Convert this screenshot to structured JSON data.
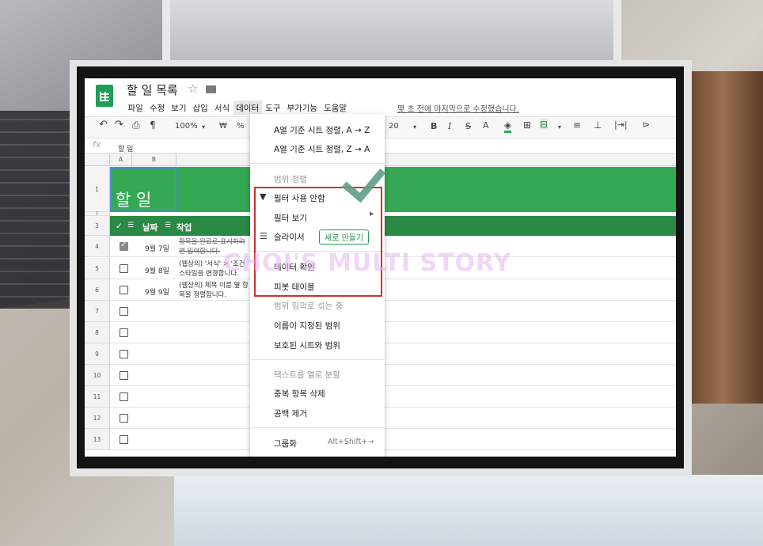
{
  "document": {
    "title": "할 일 목록",
    "fx_value": "할 일"
  },
  "menubar": [
    "파일",
    "수정",
    "보기",
    "삽입",
    "서식",
    "데이터",
    "도구",
    "부가기능",
    "도움말"
  ],
  "last_edit": "몇 초 전에 마지막으로 수정했습니다.",
  "toolbar": {
    "zoom": "100%",
    "currency": "₩",
    "percent": "%",
    "font_size": "20",
    "bold": "B",
    "italic": "I",
    "strike": "S",
    "text_color": "A"
  },
  "columns": [
    "A",
    "B"
  ],
  "sheet": {
    "title": "할 일",
    "headers": {
      "check": "✓",
      "date": "날짜",
      "task": "작업"
    },
    "rows": [
      {
        "num": "4",
        "checked": true,
        "date": "9월 7일",
        "task": "항목을 완료로 표시하려면 입력합니다."
      },
      {
        "num": "5",
        "checked": false,
        "date": "9월 8일",
        "task": "(웹상의) '서식' > '조건 스타일을 변경합니다."
      },
      {
        "num": "6",
        "checked": false,
        "date": "9월 9일",
        "task": "(웹상의) 제목 이름 옆 항목을 정렬합니다."
      },
      {
        "num": "7",
        "checked": false,
        "date": "",
        "task": ""
      },
      {
        "num": "8",
        "checked": false,
        "date": "",
        "task": ""
      },
      {
        "num": "9",
        "checked": false,
        "date": "",
        "task": ""
      },
      {
        "num": "10",
        "checked": false,
        "date": "",
        "task": ""
      },
      {
        "num": "11",
        "checked": false,
        "date": "",
        "task": ""
      },
      {
        "num": "12",
        "checked": false,
        "date": "",
        "task": ""
      },
      {
        "num": "13",
        "checked": false,
        "date": "",
        "task": ""
      }
    ]
  },
  "data_menu": {
    "sort_az": "A열 기준 시트 정렬, A → Z",
    "sort_za": "A열 기준 시트 정렬, Z → A",
    "sort_range": "범위 정렬",
    "filter_off": "필터 사용 안함",
    "filter_view": "필터 보기",
    "slicer": "슬라이서",
    "new_button": "새로 만들기",
    "data_validation": "데이터 확인",
    "pivot_table": "피봇 테이블",
    "randomize": "범위 임의로 섞는 중",
    "named_ranges": "이름이 지정된 범위",
    "protected": "보호된 시트와 범위",
    "split_text": "텍스트를 열로 분할",
    "remove_duplicates": "중복 항목 삭제",
    "trim_whitespace": "공백 제거",
    "group": "그룹화",
    "group_shortcut": "Alt+Shift+→"
  },
  "watermark": "CHOI'S MULTI STORY",
  "colors": {
    "sheet_green": "#34a853",
    "highlight_red": "#d32f2f",
    "check_mark": "#5f9e85"
  }
}
